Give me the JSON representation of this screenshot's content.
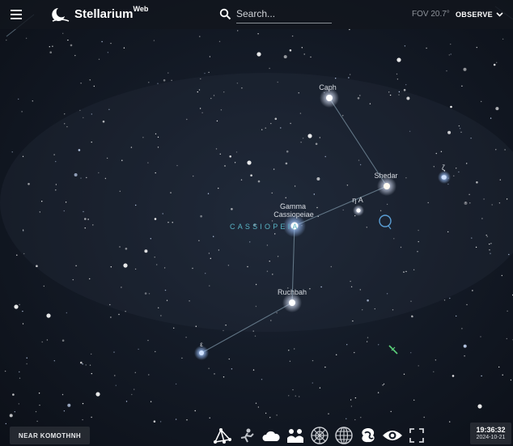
{
  "header": {
    "app_name": "Stellarium",
    "app_suffix": "Web",
    "search_placeholder": "Search...",
    "fov": "FOV 20.7°",
    "observe_label": "OBSERVE"
  },
  "sky": {
    "constellation_name": "CASSIOPEIA",
    "star_labels": {
      "caph": "Caph",
      "shedar": "Shedar",
      "gamma_line1": "Gamma",
      "gamma_line2": "Cassiopeiae",
      "ruchbah": "Ruchbah",
      "eta": "η A",
      "zeta": "ζ",
      "epsilon": "ε"
    }
  },
  "footer": {
    "location": "NEAR KOMOTHNH",
    "time": "19:36:32",
    "date": "2024-10-21"
  },
  "toolbar": {
    "buttons": [
      "constellation-lines-icon",
      "constellation-art-icon",
      "atmosphere-icon",
      "landscape-icon",
      "azimuthal-grid-icon",
      "equatorial-grid-icon",
      "nebulae-icon",
      "night-mode-icon",
      "fullscreen-icon"
    ]
  },
  "colors": {
    "sky": "#141b27",
    "constellation_label": "#59b3c4",
    "star_label": "#d9dde3",
    "selection_circle": "#5b9fd6"
  }
}
